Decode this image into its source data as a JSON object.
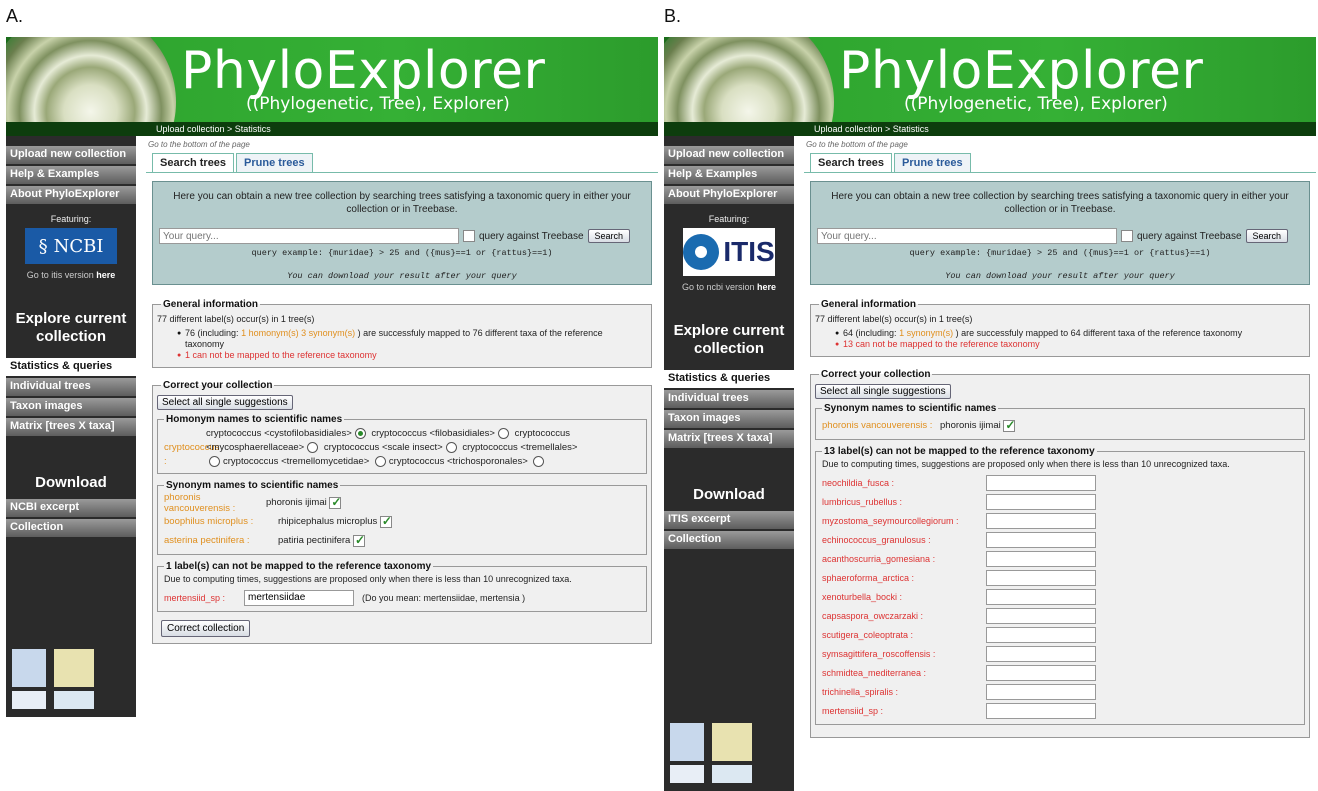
{
  "panels": {
    "a": {
      "letter": "A.",
      "app_title": "PhyloExplorer",
      "app_subtitle": "((Phylogenetic, Tree), Explorer)",
      "breadcrumb": "Upload collection > Statistics",
      "sidebar": {
        "nav_top": [
          "Upload new collection",
          "Help & Examples",
          "About PhyloExplorer"
        ],
        "featuring": "Featuring:",
        "logo_text": "NCBI",
        "go_link_prefix": "Go to itis version",
        "go_link_here": "here",
        "explore_title": "Explore current collection",
        "explore_items": [
          "Statistics & queries",
          "Individual trees",
          "Taxon images",
          "Matrix [trees X taxa]"
        ],
        "download_title": "Download",
        "download_items": [
          "NCBI excerpt",
          "Collection"
        ]
      },
      "goto_bottom": "Go to the bottom of the page",
      "tabs": [
        "Search trees",
        "Prune trees"
      ],
      "search": {
        "description": "Here you can obtain a new tree collection by searching trees satisfying a taxonomic query in either your collection or in Treebase.",
        "placeholder": "Your query...",
        "treebase_label": "query against Treebase",
        "button": "Search",
        "example": "query example: {muridae} > 25 and ({mus}==1 or {rattus}==1)",
        "note": "You can download your result after your query"
      },
      "general": {
        "legend": "General information",
        "summary": "77 different label(s) occur(s) in 1 tree(s)",
        "mapped_prefix": "76 (including:",
        "mapped_highlight": "1 homonym(s) 3 synonym(s)",
        "mapped_suffix": ") are successfuly mapped to 76 different taxa of the reference taxonomy",
        "unmapped": "1 can not be mapped to the reference taxonomy"
      },
      "correct": {
        "legend": "Correct your collection",
        "select_all": "Select all single suggestions",
        "homonym_legend": "Homonym names to scientific names",
        "homonym_name": "cryptococcus :",
        "homonym_opts": [
          "cryptococcus <cystofilobasidiales>",
          "cryptococcus <filobasidiales>",
          "cryptococcus <mycosphaerellaceae>",
          "cryptococcus <scale insect>",
          "cryptococcus <tremellales>",
          "cryptococcus <tremellomycetidae>",
          "cryptococcus <trichosporonales>"
        ],
        "synonym_legend": "Synonym names to scientific names",
        "synonyms": [
          {
            "name": "phoronis vancouverensis :",
            "value": "phoronis ijimai"
          },
          {
            "name": "boophilus microplus :",
            "value": "rhipicephalus microplus"
          },
          {
            "name": "asterina pectinifera :",
            "value": "patiria pectinifera"
          }
        ],
        "unmapped_legend": "1 label(s) can not be mapped to the reference taxonomy",
        "unmapped_note": "Due to computing times, suggestions are proposed only when there is less than 10 unrecognized taxa.",
        "unmapped_name": "mertensiid_sp :",
        "unmapped_value": "mertensiidae",
        "unmapped_hint": "(Do you mean:   mertensiidae, mertensia )",
        "correct_button": "Correct collection"
      }
    },
    "b": {
      "letter": "B.",
      "app_title": "PhyloExplorer",
      "app_subtitle": "((Phylogenetic, Tree), Explorer)",
      "breadcrumb": "Upload collection > Statistics",
      "sidebar": {
        "nav_top": [
          "Upload new collection",
          "Help & Examples",
          "About PhyloExplorer"
        ],
        "featuring": "Featuring:",
        "logo_text": "ITIS",
        "go_link_prefix": "Go to ncbi version",
        "go_link_here": "here",
        "explore_title": "Explore current collection",
        "explore_items": [
          "Statistics & queries",
          "Individual trees",
          "Taxon images",
          "Matrix [trees X taxa]"
        ],
        "download_title": "Download",
        "download_items": [
          "ITIS excerpt",
          "Collection"
        ]
      },
      "goto_bottom": "Go to the bottom of the page",
      "tabs": [
        "Search trees",
        "Prune trees"
      ],
      "search": {
        "description": "Here you can obtain a new tree collection by searching trees satisfying a taxonomic query in either your collection or in Treebase.",
        "placeholder": "Your query...",
        "treebase_label": "query against Treebase",
        "button": "Search",
        "example": "query example: {muridae} > 25 and ({mus}==1 or {rattus}==1)",
        "note": "You can download your result after your query"
      },
      "general": {
        "legend": "General information",
        "summary": "77 different label(s) occur(s) in 1 tree(s)",
        "mapped_prefix": "64 (including:",
        "mapped_highlight": "1 synonym(s)",
        "mapped_suffix": ") are successfuly mapped to 64 different taxa of the reference taxonomy",
        "unmapped": "13 can not be mapped to the reference taxonomy"
      },
      "correct": {
        "legend": "Correct your collection",
        "select_all": "Select all single suggestions",
        "synonym_legend": "Synonym names to scientific names",
        "synonyms": [
          {
            "name": "phoronis vancouverensis :",
            "value": "phoronis ijimai"
          }
        ],
        "unmapped_legend": "13 label(s) can not be mapped to the reference taxonomy",
        "unmapped_note": "Due to computing times, suggestions are proposed only when there is less than 10 unrecognized taxa.",
        "unmapped_names": [
          "neochildia_fusca :",
          "lumbricus_rubellus :",
          "myzostoma_seymourcollegiorum :",
          "echinococcus_granulosus :",
          "acanthoscurria_gomesiana :",
          "sphaeroforma_arctica :",
          "xenoturbella_bocki :",
          "capsaspora_owczarzaki :",
          "scutigera_coleoptrata :",
          "symsagittifera_roscoffensis :",
          "schmidtea_mediterranea :",
          "trichinella_spiralis :",
          "mertensiid_sp :"
        ]
      }
    }
  },
  "colors": {
    "banner_green": "#35b035",
    "sidebar_dark": "#2b2b2b",
    "search_panel": "#b4cccc",
    "synonym_orange": "#e09020",
    "error_red": "#d33"
  }
}
